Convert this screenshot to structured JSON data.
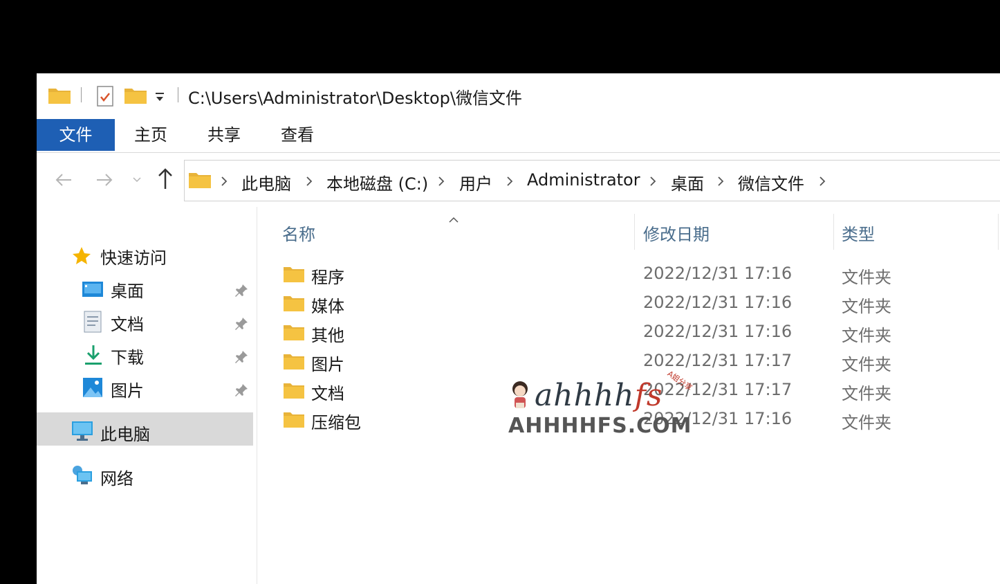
{
  "title": {
    "path": "C:\\Users\\Administrator\\Desktop\\微信文件"
  },
  "ribbon": {
    "tabs": [
      "文件",
      "主页",
      "共享",
      "查看"
    ]
  },
  "address": {
    "crumbs": [
      "此电脑",
      "本地磁盘 (C:)",
      "用户",
      "Administrator",
      "桌面",
      "微信文件"
    ]
  },
  "sidebar": {
    "quick_access": "快速访问",
    "items": [
      "桌面",
      "文档",
      "下载",
      "图片"
    ],
    "this_pc": "此电脑",
    "network": "网络"
  },
  "columns": {
    "name": "名称",
    "modified": "修改日期",
    "type": "类型"
  },
  "files": [
    {
      "name": "程序",
      "date": "2022/12/31 17:16",
      "type": "文件夹"
    },
    {
      "name": "媒体",
      "date": "2022/12/31 17:16",
      "type": "文件夹"
    },
    {
      "name": "其他",
      "date": "2022/12/31 17:16",
      "type": "文件夹"
    },
    {
      "name": "图片",
      "date": "2022/12/31 17:17",
      "type": "文件夹"
    },
    {
      "name": "文档",
      "date": "2022/12/31 17:17",
      "type": "文件夹"
    },
    {
      "name": "压缩包",
      "date": "2022/12/31 17:16",
      "type": "文件夹"
    }
  ],
  "watermark": {
    "script_main": "ahhhh",
    "script_end": "fs",
    "tag": "A姐分享",
    "domain": "AHHHHFS.COM"
  },
  "colors": {
    "accent": "#1e5fb4",
    "folder": "#f5c342",
    "selected_bg": "#d9d9d9"
  }
}
